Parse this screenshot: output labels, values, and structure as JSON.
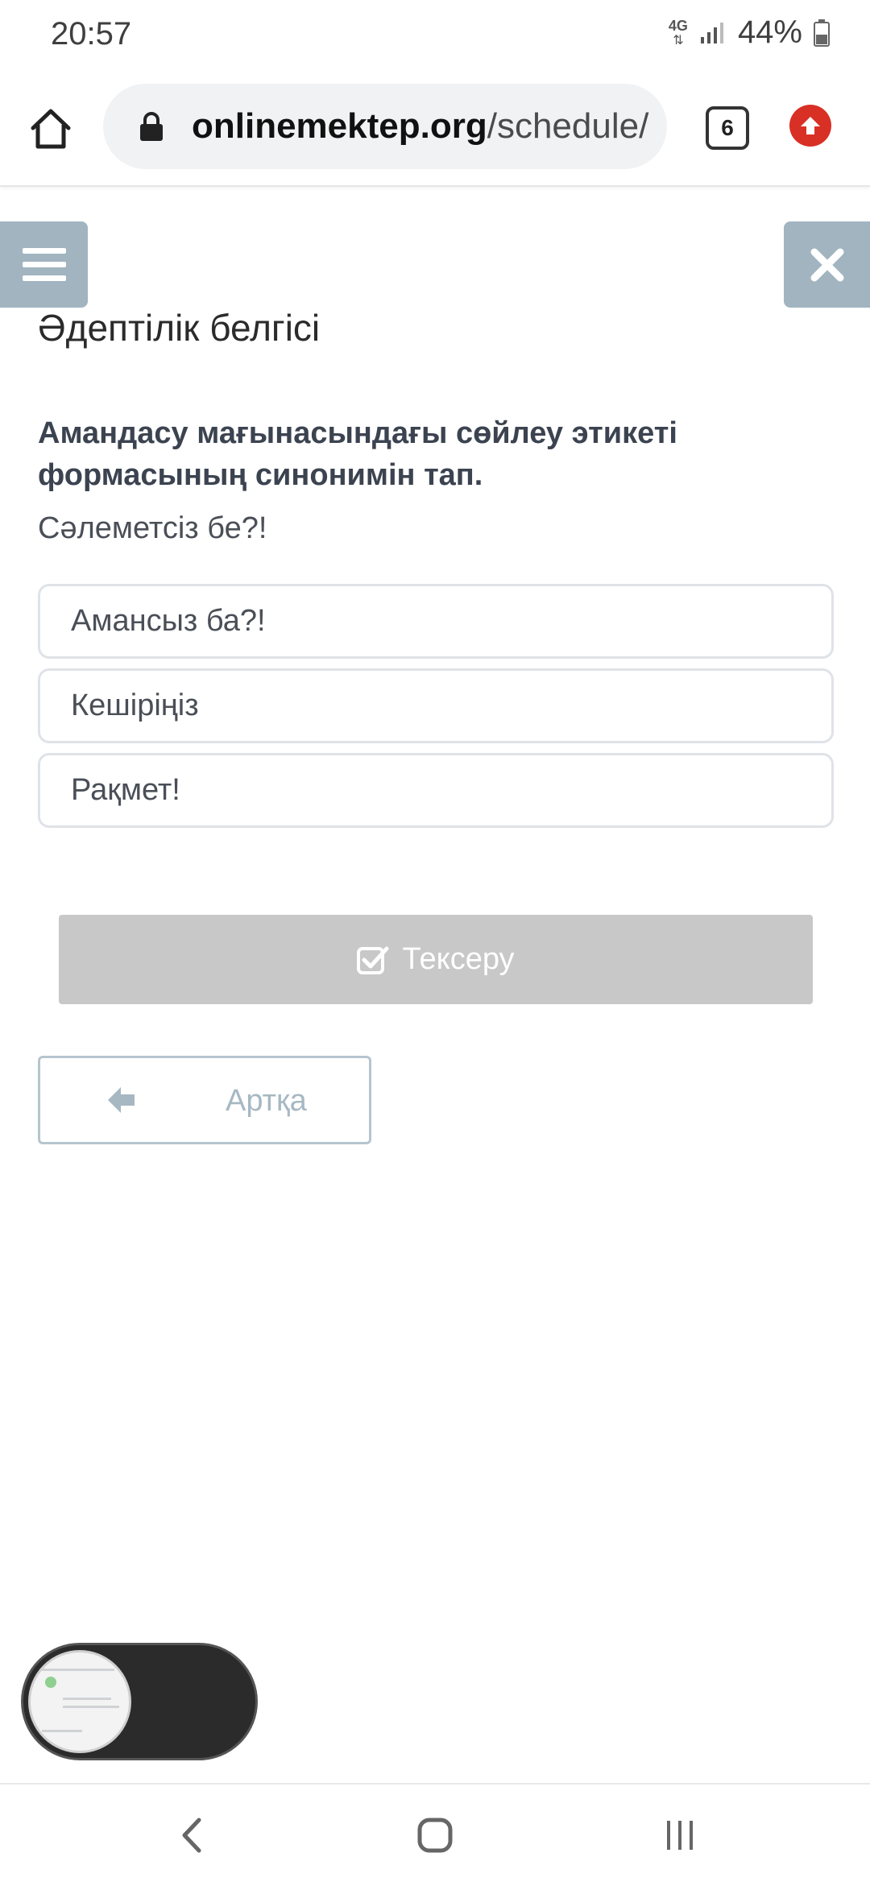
{
  "status_bar": {
    "time": "20:57",
    "network": "4G",
    "battery": "44%"
  },
  "browser": {
    "url_host": "onlinemektep.org",
    "url_path": "/schedule/",
    "tab_count": "6",
    "icons": [
      "home-icon",
      "lock-icon",
      "tab-switcher",
      "update-icon"
    ]
  },
  "page": {
    "title": "Әдептілік белгісі",
    "question": "Амандасу мағынасындағы сөйлеу этикеті формасының синонимін тап.",
    "prompt": "Сәлеметсіз бе?!",
    "options": [
      {
        "label": "Амансыз ба?!"
      },
      {
        "label": "Кешіріңіз"
      },
      {
        "label": "Рақмет!"
      }
    ],
    "check_label": "Тексеру",
    "back_label": "Артқа"
  },
  "colors": {
    "side_button": "#a1b4c0",
    "check_button_disabled": "#c8c8c8",
    "back_button_text": "#a7b8c3",
    "update_button": "#d93025"
  }
}
